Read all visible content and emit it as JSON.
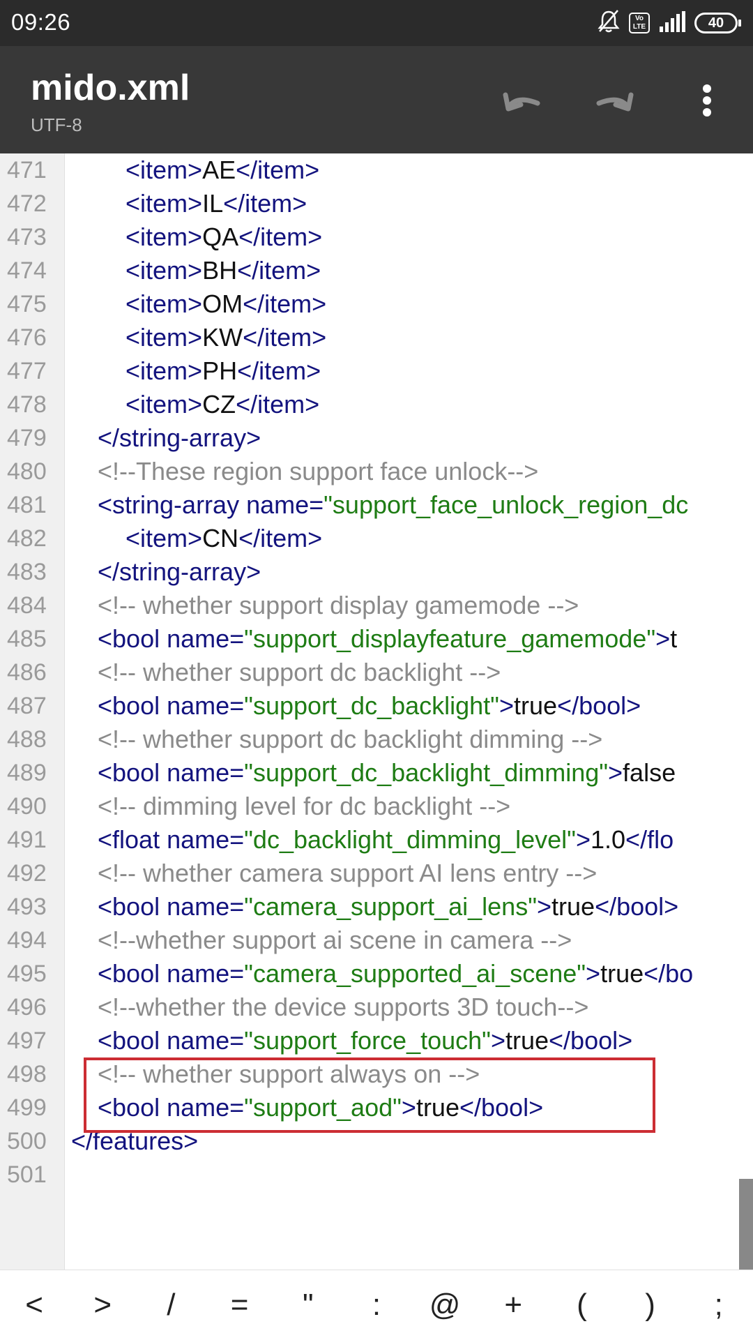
{
  "status": {
    "time": "09:26",
    "volte": "Vo LTE",
    "battery": "40"
  },
  "appbar": {
    "title": "mido.xml",
    "encoding": "UTF-8"
  },
  "icons": {
    "bell_off": "bell-off-icon",
    "undo": "undo-icon",
    "redo": "redo-icon",
    "more": "more-vert-icon"
  },
  "editor": {
    "lines": [
      {
        "num": "471",
        "indent": 2,
        "tokens": [
          {
            "k": "t",
            "s": "<item>"
          },
          {
            "k": "x",
            "s": "AE"
          },
          {
            "k": "t",
            "s": "</item>"
          }
        ]
      },
      {
        "num": "472",
        "indent": 2,
        "tokens": [
          {
            "k": "t",
            "s": "<item>"
          },
          {
            "k": "x",
            "s": "IL"
          },
          {
            "k": "t",
            "s": "</item>"
          }
        ]
      },
      {
        "num": "473",
        "indent": 2,
        "tokens": [
          {
            "k": "t",
            "s": "<item>"
          },
          {
            "k": "x",
            "s": "QA"
          },
          {
            "k": "t",
            "s": "</item>"
          }
        ]
      },
      {
        "num": "474",
        "indent": 2,
        "tokens": [
          {
            "k": "t",
            "s": "<item>"
          },
          {
            "k": "x",
            "s": "BH"
          },
          {
            "k": "t",
            "s": "</item>"
          }
        ]
      },
      {
        "num": "475",
        "indent": 2,
        "tokens": [
          {
            "k": "t",
            "s": "<item>"
          },
          {
            "k": "x",
            "s": "OM"
          },
          {
            "k": "t",
            "s": "</item>"
          }
        ]
      },
      {
        "num": "476",
        "indent": 2,
        "tokens": [
          {
            "k": "t",
            "s": "<item>"
          },
          {
            "k": "x",
            "s": "KW"
          },
          {
            "k": "t",
            "s": "</item>"
          }
        ]
      },
      {
        "num": "477",
        "indent": 2,
        "tokens": [
          {
            "k": "t",
            "s": "<item>"
          },
          {
            "k": "x",
            "s": "PH"
          },
          {
            "k": "t",
            "s": "</item>"
          }
        ]
      },
      {
        "num": "478",
        "indent": 2,
        "tokens": [
          {
            "k": "t",
            "s": "<item>"
          },
          {
            "k": "x",
            "s": "CZ"
          },
          {
            "k": "t",
            "s": "</item>"
          }
        ]
      },
      {
        "num": "479",
        "indent": 1,
        "tokens": [
          {
            "k": "t",
            "s": "</string-array>"
          }
        ]
      },
      {
        "num": "480",
        "indent": 1,
        "tokens": [
          {
            "k": "c",
            "s": "<!--These region support face unlock-->"
          }
        ]
      },
      {
        "num": "481",
        "indent": 1,
        "tokens": [
          {
            "k": "t",
            "s": "<string-array "
          },
          {
            "k": "a",
            "s": "name="
          },
          {
            "k": "v",
            "s": "\"support_face_unlock_region_dc"
          }
        ]
      },
      {
        "num": "482",
        "indent": 2,
        "tokens": [
          {
            "k": "t",
            "s": "<item>"
          },
          {
            "k": "x",
            "s": "CN"
          },
          {
            "k": "t",
            "s": "</item>"
          }
        ]
      },
      {
        "num": "483",
        "indent": 1,
        "tokens": [
          {
            "k": "t",
            "s": "</string-array>"
          }
        ]
      },
      {
        "num": "484",
        "indent": 1,
        "tokens": [
          {
            "k": "c",
            "s": "<!-- whether support display gamemode -->"
          }
        ]
      },
      {
        "num": "485",
        "indent": 1,
        "tokens": [
          {
            "k": "t",
            "s": "<bool "
          },
          {
            "k": "a",
            "s": "name="
          },
          {
            "k": "v",
            "s": "\"support_displayfeature_gamemode\""
          },
          {
            "k": "t",
            "s": ">"
          },
          {
            "k": "x",
            "s": "t"
          }
        ]
      },
      {
        "num": "486",
        "indent": 1,
        "tokens": [
          {
            "k": "c",
            "s": "<!-- whether support dc backlight -->"
          }
        ]
      },
      {
        "num": "487",
        "indent": 1,
        "tokens": [
          {
            "k": "t",
            "s": "<bool "
          },
          {
            "k": "a",
            "s": "name="
          },
          {
            "k": "v",
            "s": "\"support_dc_backlight\""
          },
          {
            "k": "t",
            "s": ">"
          },
          {
            "k": "x",
            "s": "true"
          },
          {
            "k": "t",
            "s": "</bool>"
          }
        ]
      },
      {
        "num": "488",
        "indent": 1,
        "tokens": [
          {
            "k": "c",
            "s": "<!-- whether support dc backlight dimming -->"
          }
        ]
      },
      {
        "num": "489",
        "indent": 1,
        "tokens": [
          {
            "k": "t",
            "s": "<bool "
          },
          {
            "k": "a",
            "s": "name="
          },
          {
            "k": "v",
            "s": "\"support_dc_backlight_dimming\""
          },
          {
            "k": "t",
            "s": ">"
          },
          {
            "k": "x",
            "s": "false"
          }
        ]
      },
      {
        "num": "490",
        "indent": 1,
        "tokens": [
          {
            "k": "c",
            "s": "<!-- dimming level for dc backlight -->"
          }
        ]
      },
      {
        "num": "491",
        "indent": 1,
        "tokens": [
          {
            "k": "t",
            "s": "<float "
          },
          {
            "k": "a",
            "s": "name="
          },
          {
            "k": "v",
            "s": "\"dc_backlight_dimming_level\""
          },
          {
            "k": "t",
            "s": ">"
          },
          {
            "k": "x",
            "s": "1.0"
          },
          {
            "k": "t",
            "s": "</flo"
          }
        ]
      },
      {
        "num": "492",
        "indent": 1,
        "tokens": [
          {
            "k": "c",
            "s": "<!-- whether camera support AI lens entry -->"
          }
        ]
      },
      {
        "num": "493",
        "indent": 1,
        "tokens": [
          {
            "k": "t",
            "s": "<bool "
          },
          {
            "k": "a",
            "s": "name="
          },
          {
            "k": "v",
            "s": "\"camera_support_ai_lens\""
          },
          {
            "k": "t",
            "s": ">"
          },
          {
            "k": "x",
            "s": "true"
          },
          {
            "k": "t",
            "s": "</bool>"
          }
        ]
      },
      {
        "num": "494",
        "indent": 1,
        "tokens": [
          {
            "k": "c",
            "s": "<!--whether support ai scene in camera -->"
          }
        ]
      },
      {
        "num": "495",
        "indent": 1,
        "tokens": [
          {
            "k": "t",
            "s": "<bool "
          },
          {
            "k": "a",
            "s": "name="
          },
          {
            "k": "v",
            "s": "\"camera_supported_ai_scene\""
          },
          {
            "k": "t",
            "s": ">"
          },
          {
            "k": "x",
            "s": "true"
          },
          {
            "k": "t",
            "s": "</bo"
          }
        ]
      },
      {
        "num": "496",
        "indent": 1,
        "tokens": [
          {
            "k": "c",
            "s": "<!--whether the device supports 3D touch-->"
          }
        ]
      },
      {
        "num": "497",
        "indent": 1,
        "tokens": [
          {
            "k": "t",
            "s": "<bool "
          },
          {
            "k": "a",
            "s": "name="
          },
          {
            "k": "v",
            "s": "\"support_force_touch\""
          },
          {
            "k": "t",
            "s": ">"
          },
          {
            "k": "x",
            "s": "true"
          },
          {
            "k": "t",
            "s": "</bool>"
          }
        ]
      },
      {
        "num": "498",
        "indent": 1,
        "tokens": [
          {
            "k": "c",
            "s": "<!-- whether support always on -->"
          }
        ]
      },
      {
        "num": "499",
        "indent": 1,
        "tokens": [
          {
            "k": "t",
            "s": "<bool "
          },
          {
            "k": "a",
            "s": "name="
          },
          {
            "k": "v",
            "s": "\"support_aod\""
          },
          {
            "k": "t",
            "s": ">"
          },
          {
            "k": "x",
            "s": "true"
          },
          {
            "k": "t",
            "s": "</bool>"
          }
        ]
      },
      {
        "num": "500",
        "indent": 0,
        "tokens": [
          {
            "k": "t",
            "s": "</features>"
          }
        ]
      },
      {
        "num": "501",
        "indent": 0,
        "tokens": []
      }
    ]
  },
  "keybar": {
    "keys": [
      "<",
      ">",
      "/",
      "=",
      "\"",
      ":",
      "@",
      "+",
      "(",
      ")",
      ";"
    ]
  },
  "colors": {
    "tag": "#13137e",
    "value": "#1e7c14",
    "comment": "#8a8a8a",
    "highlight": "#cc2d33",
    "appbar": "#383838",
    "statusbar": "#2b2b2b"
  }
}
